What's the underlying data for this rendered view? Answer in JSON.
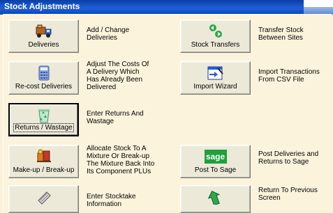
{
  "window": {
    "title": "Stock Adjustments"
  },
  "buttons": {
    "deliveries": {
      "label": "Deliveries",
      "icon": "delivery-truck-icon",
      "description": "Add / Change\nDeliveries"
    },
    "stock_transfers": {
      "label": "Stock Transfers",
      "icon": "transfer-arrows-icon",
      "description": "Transfer Stock\nBetween Sites"
    },
    "recost_deliveries": {
      "label": "Re-cost Deliveries",
      "icon": "calculator-icon",
      "description": "Adjust The Costs Of\nA Delivery Which\nHas Already Been\nDelivered"
    },
    "import_wizard": {
      "label": "Import Wizard",
      "icon": "import-wizard-icon",
      "description": "Import Transactions\nFrom CSV File"
    },
    "returns_wastage": {
      "label": "Returns / Wastage",
      "icon": "recycle-bin-icon",
      "description": "Enter Returns And\nWastage"
    },
    "makeup_breakup": {
      "label": "Make-up /  Break-up",
      "icon": "components-icon",
      "description": "Allocate Stock To A\nMixture Or Break-up\nThe Mixture Back Into\nIts Component PLUs"
    },
    "post_to_sage": {
      "label": "Post To Sage",
      "icon": "sage-logo-icon",
      "logo_text": "sage",
      "description": "Post Deliveries and\nReturns to Sage"
    },
    "stocktake": {
      "label": "",
      "icon": "stocktake-clipboard-icon",
      "description": "Enter Stocktake\nInformation"
    },
    "return_previous": {
      "label": "",
      "icon": "return-arrow-icon",
      "description": "Return To Previous\nScreen"
    }
  },
  "colors": {
    "title_bar": "#1f5fd6",
    "panel_bg": "#fcf3dc",
    "button_face": "#ece9d8",
    "sage_green": "#1fa03b"
  }
}
